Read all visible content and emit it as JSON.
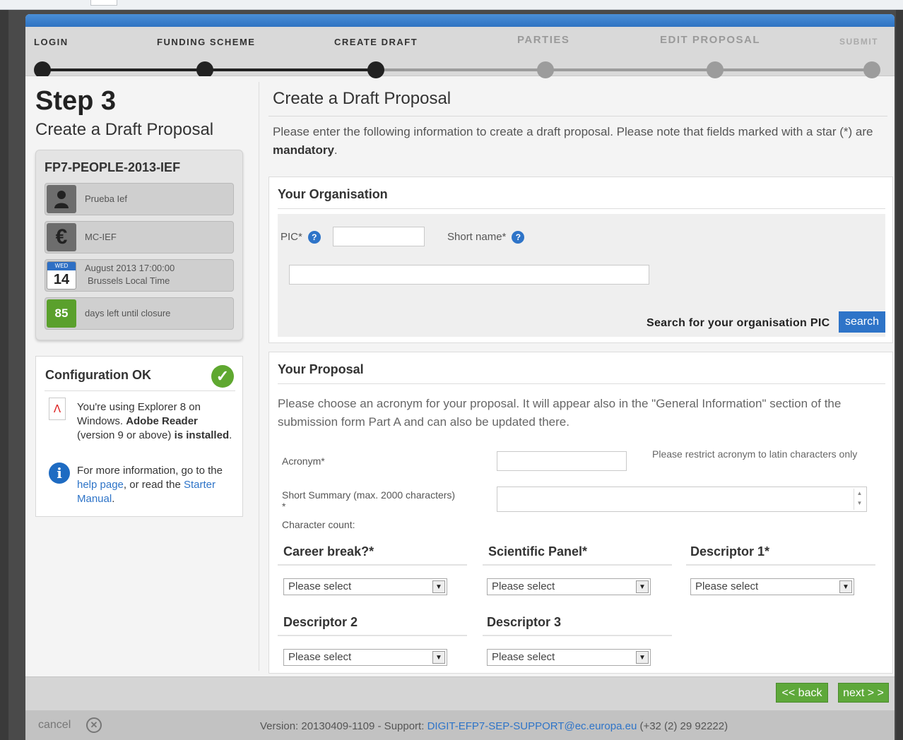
{
  "steps": [
    {
      "label": "LOGIN",
      "state": "done"
    },
    {
      "label": "FUNDING SCHEME",
      "state": "done"
    },
    {
      "label": "CREATE DRAFT",
      "state": "current"
    },
    {
      "label": "PARTIES",
      "state": "todo"
    },
    {
      "label": "EDIT PROPOSAL",
      "state": "todo"
    },
    {
      "label": "SUBMIT",
      "state": "todo"
    }
  ],
  "left": {
    "step_number": "Step 3",
    "step_title": "Create a Draft Proposal",
    "call_id": "FP7-PEOPLE-2013-IEF",
    "items": [
      {
        "icon": "person-icon",
        "text": "Prueba Ief"
      },
      {
        "icon": "euro-icon",
        "text": "MC-IEF"
      }
    ],
    "deadline": {
      "weekday": "WED",
      "day": "14",
      "line1": "August 2013 17:00:00",
      "line2": "Brussels Local Time"
    },
    "days_left": {
      "count": "85",
      "text": "days left until closure"
    },
    "config": {
      "title": "Configuration OK",
      "msg_a": "You're using Explorer 8 on Windows. ",
      "msg_b": "Adobe Reader",
      "msg_c": " (version 9 or above) ",
      "msg_d": "is installed",
      "msg_e": ".",
      "more_a": "For more information, go to the ",
      "help_link": "help page",
      "more_b": ", or read the ",
      "manual_link": "Starter Manual",
      "more_c": "."
    }
  },
  "main": {
    "title": "Create a Draft Proposal",
    "intro_a": "Please enter the following information to create a draft proposal. Please note that fields marked with a star (*) are ",
    "intro_bold": "mandatory",
    "intro_c": ".",
    "org": {
      "title": "Your Organisation",
      "pic_label": "PIC*",
      "short_name_label": "Short name*",
      "help_mark": "?",
      "search_label": "Search for your organisation PIC",
      "search_button": "search"
    },
    "proposal": {
      "title": "Your Proposal",
      "description": "Please choose an acronym for your proposal. It will appear also in the \"General Information\" section of the submission form Part A and can also be updated there.",
      "acronym_label": "Acronym*",
      "acronym_hint": "Please restrict acronym to latin characters only",
      "summary_label": "Short Summary (max. 2000 characters)",
      "summary_star": "*",
      "char_count_label": "Character count:",
      "selects": [
        {
          "label": "Career break?*",
          "value": "Please select"
        },
        {
          "label": "Scientific Panel*",
          "value": "Please select"
        },
        {
          "label": "Descriptor 1*",
          "value": "Please select"
        },
        {
          "label": "Descriptor 2",
          "value": "Please select"
        },
        {
          "label": "Descriptor 3",
          "value": "Please select"
        }
      ]
    }
  },
  "nav": {
    "back": "<< back",
    "next": "next > >"
  },
  "footer": {
    "cancel": "cancel",
    "version_text": "Version: 20130409-1109 - Support: ",
    "support_email": "DIGIT-EFP7-SEP-SUPPORT@ec.europa.eu",
    "phone": " (+32 (2) 29 92222)"
  },
  "colors": {
    "accent_blue": "#2e74c8",
    "green": "#5ea83a"
  }
}
